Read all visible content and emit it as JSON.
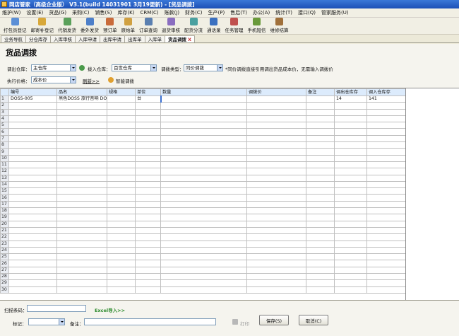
{
  "window": {
    "title": "网店管家（高级企业版） V3.1(build 14031901 3月19更新) - [货品调拨]"
  },
  "menu": [
    "维护(W)",
    "设置(E)",
    "货品(G)",
    "采购(C)",
    "销售(S)",
    "库存(K)",
    "CRM(C)",
    "账款(J)",
    "财务(C)",
    "生产(P)",
    "售后(T)",
    "办公(A)",
    "统计(T)",
    "接口(Q)",
    "管家服务(U)"
  ],
  "toolbar": [
    {
      "label": "打包员登记",
      "icon": "package-icon",
      "color": "#5b8fd6"
    },
    {
      "label": "邮寄补登记",
      "icon": "mail-icon",
      "color": "#d8a83a"
    },
    {
      "label": "代销发货",
      "icon": "truck-icon",
      "color": "#5aa05a"
    },
    {
      "label": "委外发货",
      "icon": "ship-icon",
      "color": "#4d7fc9"
    },
    {
      "label": "预订单",
      "icon": "order-icon",
      "color": "#c96b3a"
    },
    {
      "label": "原始单",
      "icon": "document-icon",
      "color": "#d0a040"
    },
    {
      "label": "订单查询",
      "icon": "search-icon",
      "color": "#5a7fb0"
    },
    {
      "label": "退货审核",
      "icon": "return-icon",
      "color": "#8a6dc0"
    },
    {
      "label": "配货分流",
      "icon": "distribute-icon",
      "color": "#4aa0a0"
    },
    {
      "label": "通话录",
      "icon": "phone-icon",
      "color": "#3a70c0"
    },
    {
      "label": "任务管理",
      "icon": "task-icon",
      "color": "#c0504d"
    },
    {
      "label": "手机短信",
      "icon": "sms-icon",
      "color": "#6a9a3a"
    },
    {
      "label": "维修结算",
      "icon": "wrench-icon",
      "color": "#a0703a"
    }
  ],
  "tabs": [
    {
      "label": "业务导航",
      "active": false
    },
    {
      "label": "分仓库存",
      "active": false
    },
    {
      "label": "入库审核",
      "active": false
    },
    {
      "label": "入库申请",
      "active": false
    },
    {
      "label": "出库申请",
      "active": false
    },
    {
      "label": "出库单",
      "active": false
    },
    {
      "label": "入库单",
      "active": false
    },
    {
      "label": "货品调拨",
      "active": true,
      "close": "X"
    }
  ],
  "form": {
    "page_title": "货品调拨",
    "out_warehouse_label": "调出仓库：",
    "out_warehouse_value": "主仓库",
    "in_warehouse_label": "拨入仓库：",
    "in_warehouse_value": "百世仓库",
    "transfer_type_label": "调拨类型：",
    "transfer_type_value": "同价调拨",
    "transfer_note": "*同价调拨直接引用调出货品成本价，无需输入调拨价",
    "price_label": "执行价格：",
    "price_value": "成本价",
    "refresh_label": "刷新>>",
    "smart_transfer_label": "智能调拨"
  },
  "grid": {
    "columns": [
      "编号",
      "品名",
      "规格",
      "单位",
      "数量",
      "调拨价",
      "备注",
      "调出仓库存",
      "调入仓库存"
    ],
    "rows": [
      [
        "DOSS-005",
        "黑色DOSS 旅行音响 DOS",
        "",
        "台",
        "",
        "",
        "",
        "14",
        "141"
      ]
    ],
    "row_numbers": [
      "1",
      "2",
      "3",
      "4",
      "5",
      "6",
      "7",
      "8",
      "9",
      "10",
      "11",
      "12",
      "13",
      "14",
      "15",
      "16",
      "17",
      "18",
      "19",
      "20",
      "21",
      "22",
      "23",
      "24",
      "25",
      "26",
      "27",
      "28",
      "29",
      "30"
    ]
  },
  "footer": {
    "scan_label": "扫描条码：",
    "excel_import": "Excel导入>>",
    "mark_label": "标记：",
    "remark_label": "备注：",
    "print_label": "打印",
    "save_label": "保存(S)",
    "cancel_label": "取消(C)"
  }
}
